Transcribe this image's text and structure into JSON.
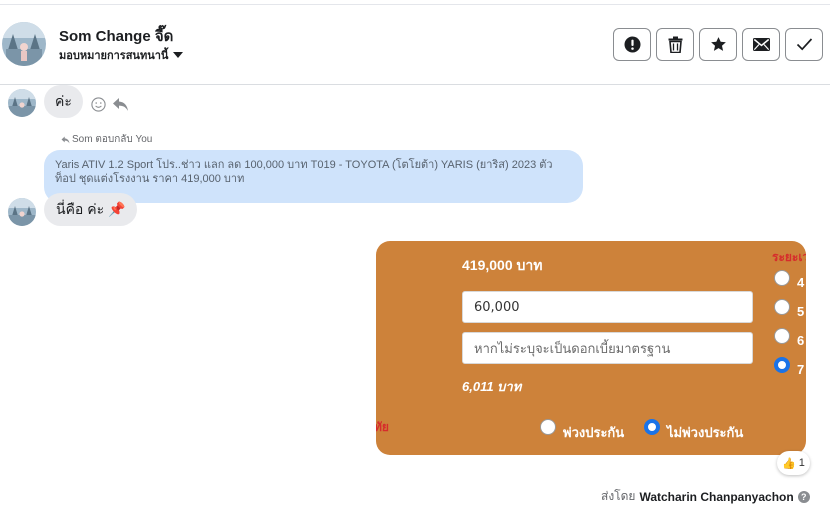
{
  "header": {
    "contact_name": "Som Change จี๊ด",
    "assign_label": "มอบหมายการสนทนานี้",
    "buttons": [
      "report-icon",
      "trash-icon",
      "star-icon",
      "mail-icon",
      "check-icon"
    ]
  },
  "thread": {
    "msg1": "ค่ะ",
    "reply_meta": "Som ตอบกลับ You",
    "quoted_text": "Yaris ATIV 1.2 Sport โปร..ช่าว แลก ลด 100,000 บาท T019 - TOYOTA (โตโยต้า) YARIS (ยาริส) 2023 ตัวท็อป ชุดแต่งโรงงาน ราคา 419,000 บาท",
    "msg2": "นี่คือ ค่ะ 📌"
  },
  "card": {
    "price": "419,000 บาท",
    "down_payment": "60,000",
    "interest_placeholder": "หากไม่ระบุจะเป็นดอกเบี้ยมาตรฐาน",
    "monthly": "6,011 บาท",
    "period_header": "ระยะเวลา",
    "periods": [
      "4",
      "5",
      "6",
      "7"
    ],
    "selected_period": "7",
    "insurance_cut_label": "ทัย",
    "insurance_with": "พ่วงประกัน",
    "insurance_without": "ไม่พ่วงประกัน",
    "insurance_selected": "ไม่พ่วงประกัน",
    "colors": {
      "background": "#cd823a",
      "accent": "#d62c2c",
      "radio": "#1a73e8"
    }
  },
  "reaction": {
    "emoji": "👍",
    "count": "1"
  },
  "sent_by": {
    "prefix": "ส่งโดย",
    "name": "Watcharin Chanpanyachon",
    "help": "?"
  }
}
